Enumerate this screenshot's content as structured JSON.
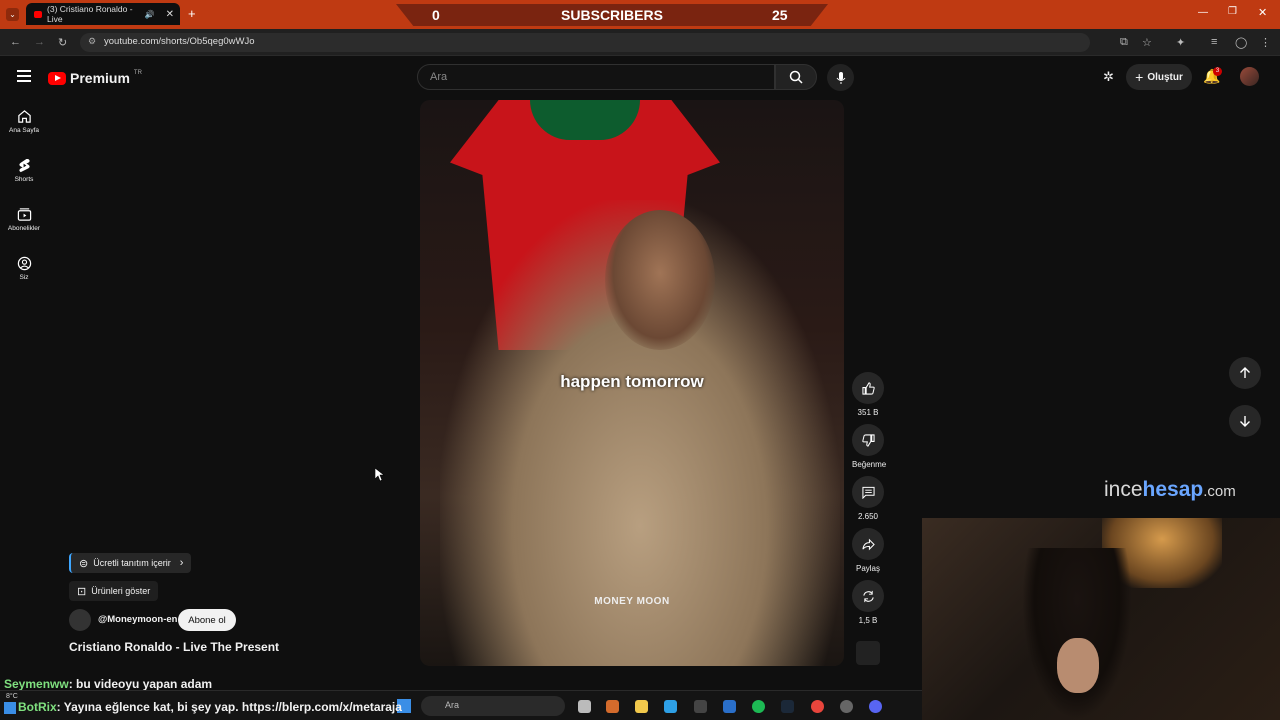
{
  "browser": {
    "tab_title": "(3) Cristiano Ronaldo - Live",
    "url": "youtube.com/shorts/Ob5qeg0wWJo"
  },
  "overlay": {
    "sub_left": "0",
    "sub_label": "SUBSCRIBERS",
    "sub_right": "25"
  },
  "header": {
    "logo_text": "Premium",
    "logo_region": "TR",
    "search_placeholder": "Ara",
    "create_label": "Oluştur",
    "notif_count": "3"
  },
  "sidebar": {
    "items": [
      {
        "label": "Ana Sayfa",
        "icon": "home-icon"
      },
      {
        "label": "Shorts",
        "icon": "shorts-icon"
      },
      {
        "label": "Abonelikler",
        "icon": "subscriptions-icon"
      },
      {
        "label": "Siz",
        "icon": "you-icon"
      }
    ]
  },
  "video": {
    "caption": "happen tomorrow",
    "watermark": "MONEY MOON"
  },
  "actions": {
    "like_count": "351 B",
    "dislike_label": "Beğenme",
    "comment_count": "2.650",
    "share_label": "Paylaş",
    "remix_count": "1,5 B"
  },
  "info": {
    "paid_promo": "Ücretli tanıtım içerir",
    "products": "Ürünleri göster",
    "channel": "@Moneymoon-en",
    "subscribe": "Abone ol",
    "title": "Cristiano Ronaldo - Live The Present"
  },
  "stream": {
    "brand_a": "ince",
    "brand_b": "hesap",
    "brand_c": ".com",
    "chat": [
      {
        "user": "Seymenww",
        "msg": ": bu videoyu yapan adam",
        "color": "#7fe07f"
      },
      {
        "user": "BotRix",
        "msg": ": Yayına eğlence kat, bi şey yap. https://blerp.com/x/metaraja",
        "color": "#7fe07f"
      }
    ],
    "weather": "8°C",
    "taskbar_search": "Ara"
  }
}
